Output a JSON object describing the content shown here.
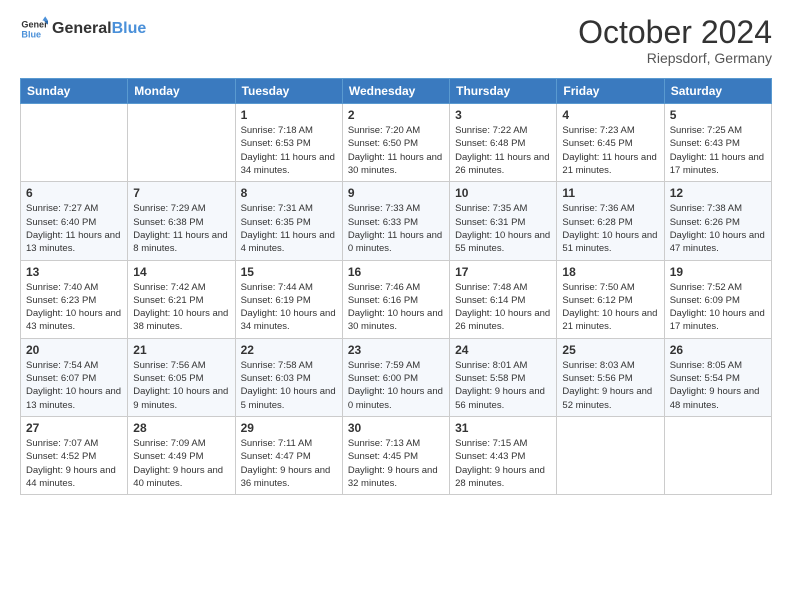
{
  "logo": {
    "text_general": "General",
    "text_blue": "Blue"
  },
  "header": {
    "month": "October 2024",
    "location": "Riepsdorf, Germany"
  },
  "weekdays": [
    "Sunday",
    "Monday",
    "Tuesday",
    "Wednesday",
    "Thursday",
    "Friday",
    "Saturday"
  ],
  "weeks": [
    [
      {
        "day": "",
        "content": ""
      },
      {
        "day": "",
        "content": ""
      },
      {
        "day": "1",
        "content": "Sunrise: 7:18 AM\nSunset: 6:53 PM\nDaylight: 11 hours and 34 minutes."
      },
      {
        "day": "2",
        "content": "Sunrise: 7:20 AM\nSunset: 6:50 PM\nDaylight: 11 hours and 30 minutes."
      },
      {
        "day": "3",
        "content": "Sunrise: 7:22 AM\nSunset: 6:48 PM\nDaylight: 11 hours and 26 minutes."
      },
      {
        "day": "4",
        "content": "Sunrise: 7:23 AM\nSunset: 6:45 PM\nDaylight: 11 hours and 21 minutes."
      },
      {
        "day": "5",
        "content": "Sunrise: 7:25 AM\nSunset: 6:43 PM\nDaylight: 11 hours and 17 minutes."
      }
    ],
    [
      {
        "day": "6",
        "content": "Sunrise: 7:27 AM\nSunset: 6:40 PM\nDaylight: 11 hours and 13 minutes."
      },
      {
        "day": "7",
        "content": "Sunrise: 7:29 AM\nSunset: 6:38 PM\nDaylight: 11 hours and 8 minutes."
      },
      {
        "day": "8",
        "content": "Sunrise: 7:31 AM\nSunset: 6:35 PM\nDaylight: 11 hours and 4 minutes."
      },
      {
        "day": "9",
        "content": "Sunrise: 7:33 AM\nSunset: 6:33 PM\nDaylight: 11 hours and 0 minutes."
      },
      {
        "day": "10",
        "content": "Sunrise: 7:35 AM\nSunset: 6:31 PM\nDaylight: 10 hours and 55 minutes."
      },
      {
        "day": "11",
        "content": "Sunrise: 7:36 AM\nSunset: 6:28 PM\nDaylight: 10 hours and 51 minutes."
      },
      {
        "day": "12",
        "content": "Sunrise: 7:38 AM\nSunset: 6:26 PM\nDaylight: 10 hours and 47 minutes."
      }
    ],
    [
      {
        "day": "13",
        "content": "Sunrise: 7:40 AM\nSunset: 6:23 PM\nDaylight: 10 hours and 43 minutes."
      },
      {
        "day": "14",
        "content": "Sunrise: 7:42 AM\nSunset: 6:21 PM\nDaylight: 10 hours and 38 minutes."
      },
      {
        "day": "15",
        "content": "Sunrise: 7:44 AM\nSunset: 6:19 PM\nDaylight: 10 hours and 34 minutes."
      },
      {
        "day": "16",
        "content": "Sunrise: 7:46 AM\nSunset: 6:16 PM\nDaylight: 10 hours and 30 minutes."
      },
      {
        "day": "17",
        "content": "Sunrise: 7:48 AM\nSunset: 6:14 PM\nDaylight: 10 hours and 26 minutes."
      },
      {
        "day": "18",
        "content": "Sunrise: 7:50 AM\nSunset: 6:12 PM\nDaylight: 10 hours and 21 minutes."
      },
      {
        "day": "19",
        "content": "Sunrise: 7:52 AM\nSunset: 6:09 PM\nDaylight: 10 hours and 17 minutes."
      }
    ],
    [
      {
        "day": "20",
        "content": "Sunrise: 7:54 AM\nSunset: 6:07 PM\nDaylight: 10 hours and 13 minutes."
      },
      {
        "day": "21",
        "content": "Sunrise: 7:56 AM\nSunset: 6:05 PM\nDaylight: 10 hours and 9 minutes."
      },
      {
        "day": "22",
        "content": "Sunrise: 7:58 AM\nSunset: 6:03 PM\nDaylight: 10 hours and 5 minutes."
      },
      {
        "day": "23",
        "content": "Sunrise: 7:59 AM\nSunset: 6:00 PM\nDaylight: 10 hours and 0 minutes."
      },
      {
        "day": "24",
        "content": "Sunrise: 8:01 AM\nSunset: 5:58 PM\nDaylight: 9 hours and 56 minutes."
      },
      {
        "day": "25",
        "content": "Sunrise: 8:03 AM\nSunset: 5:56 PM\nDaylight: 9 hours and 52 minutes."
      },
      {
        "day": "26",
        "content": "Sunrise: 8:05 AM\nSunset: 5:54 PM\nDaylight: 9 hours and 48 minutes."
      }
    ],
    [
      {
        "day": "27",
        "content": "Sunrise: 7:07 AM\nSunset: 4:52 PM\nDaylight: 9 hours and 44 minutes."
      },
      {
        "day": "28",
        "content": "Sunrise: 7:09 AM\nSunset: 4:49 PM\nDaylight: 9 hours and 40 minutes."
      },
      {
        "day": "29",
        "content": "Sunrise: 7:11 AM\nSunset: 4:47 PM\nDaylight: 9 hours and 36 minutes."
      },
      {
        "day": "30",
        "content": "Sunrise: 7:13 AM\nSunset: 4:45 PM\nDaylight: 9 hours and 32 minutes."
      },
      {
        "day": "31",
        "content": "Sunrise: 7:15 AM\nSunset: 4:43 PM\nDaylight: 9 hours and 28 minutes."
      },
      {
        "day": "",
        "content": ""
      },
      {
        "day": "",
        "content": ""
      }
    ]
  ]
}
